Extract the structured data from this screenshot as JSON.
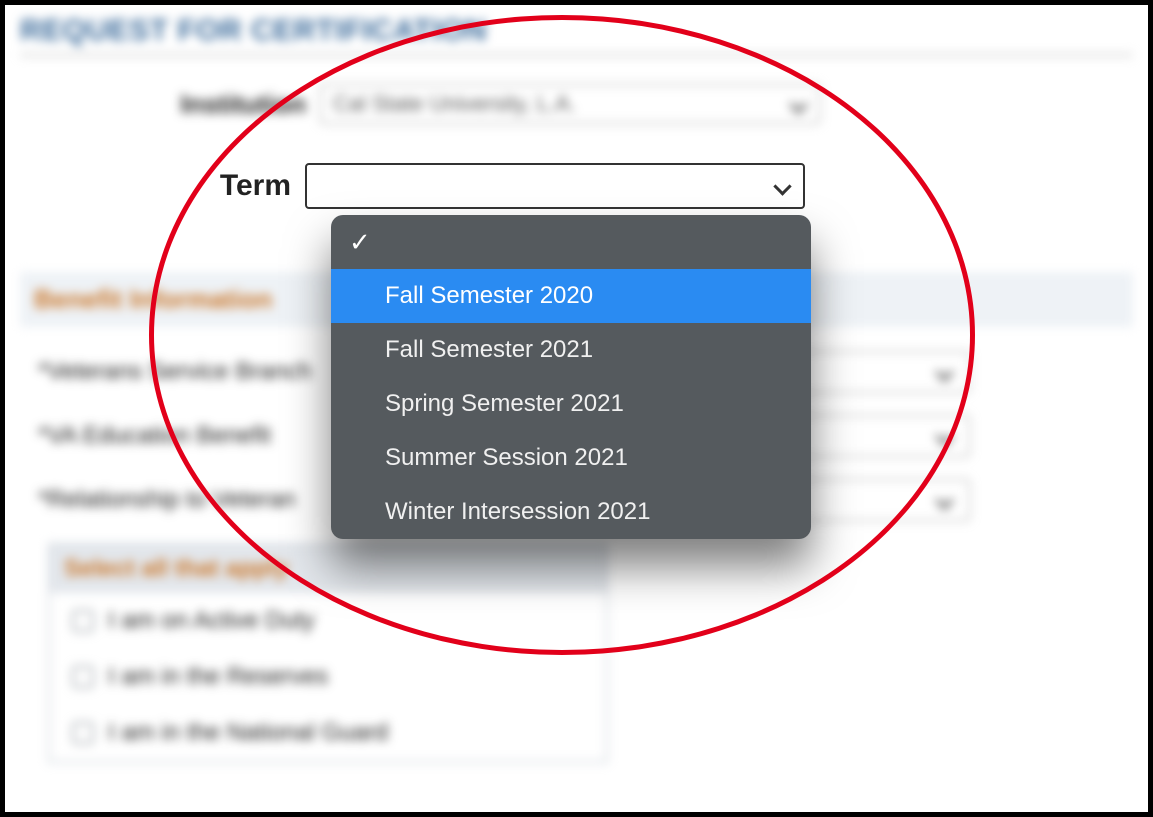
{
  "page_title": "REQUEST FOR CERTIFICATION",
  "form": {
    "institution_label": "Institution",
    "institution_value": "Cal State University, L.A.",
    "term_label": "Term",
    "term_value": "",
    "term_options": {
      "blank": "",
      "opt1": "Fall Semester 2020",
      "opt2": "Fall Semester 2021",
      "opt3": "Spring Semester 2021",
      "opt4": "Summer Session 2021",
      "opt5": "Winter Intersession 2021"
    }
  },
  "benefit": {
    "section_title": "Benefit Information",
    "branch_label": "*Veterans Service Branch",
    "va_edu_label": "*VA Education Benefit",
    "relationship_label": "*Relationship to Veteran",
    "apply_header": "Select all that apply",
    "cb1": "I am on Active Duty",
    "cb2": "I am in the Reserves",
    "cb3": "I am in the National Guard"
  }
}
